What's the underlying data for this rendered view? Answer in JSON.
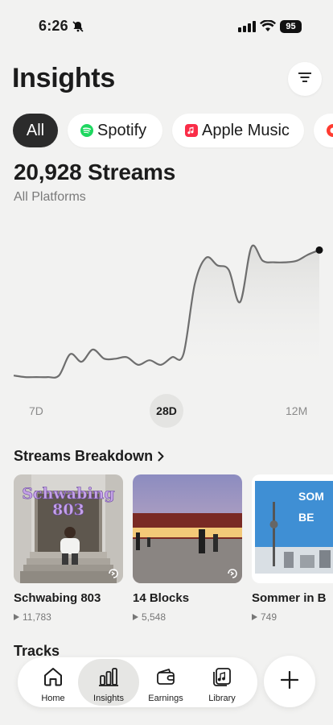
{
  "status_bar": {
    "time": "6:26",
    "battery": "95"
  },
  "header": {
    "title": "Insights"
  },
  "tabs": [
    {
      "label": "All",
      "active": true
    },
    {
      "label": "Spotify",
      "active": false
    },
    {
      "label": "Apple Music",
      "active": false
    },
    {
      "label": "",
      "active": false
    }
  ],
  "summary": {
    "total": "20,928 Streams",
    "subtitle": "All Platforms"
  },
  "chart_data": {
    "type": "line",
    "title": "",
    "xlabel": "",
    "ylabel": "",
    "x": [
      1,
      2,
      3,
      4,
      5,
      6,
      7,
      8,
      9,
      10,
      11,
      12,
      13,
      14,
      15,
      16,
      17,
      18,
      19,
      20,
      21,
      22,
      23,
      24,
      25,
      26,
      27,
      28
    ],
    "values": [
      2,
      1,
      1,
      1,
      2,
      16,
      11,
      19,
      13,
      13,
      14,
      9,
      12,
      9,
      14,
      16,
      62,
      79,
      74,
      71,
      50,
      86,
      77,
      76,
      76,
      77,
      81,
      84
    ],
    "ylim": [
      0,
      100
    ],
    "grid": false,
    "legend": "none"
  },
  "range": {
    "options": [
      "7D",
      "28D",
      "12M"
    ],
    "selected": "28D"
  },
  "breakdown": {
    "title": "Streams Breakdown",
    "items": [
      {
        "title": "Schwabing 803",
        "plays": "11,783",
        "art_text": "Schwabing 803"
      },
      {
        "title": "14 Blocks",
        "plays": "5,548"
      },
      {
        "title": "Sommer in B",
        "plays": "749",
        "art_text": "SOM BE"
      }
    ]
  },
  "tracks": {
    "title": "Tracks"
  },
  "nav": {
    "items": [
      {
        "label": "Home",
        "icon": "home-icon"
      },
      {
        "label": "Insights",
        "icon": "bar-chart-icon",
        "active": true
      },
      {
        "label": "Earnings",
        "icon": "wallet-icon"
      },
      {
        "label": "Library",
        "icon": "music-library-icon"
      }
    ]
  },
  "colors": {
    "background": "#f2f2f1",
    "accent_dark": "#2b2b2b",
    "spotify": "#1ed760",
    "apple_music": "#fa2d48"
  }
}
